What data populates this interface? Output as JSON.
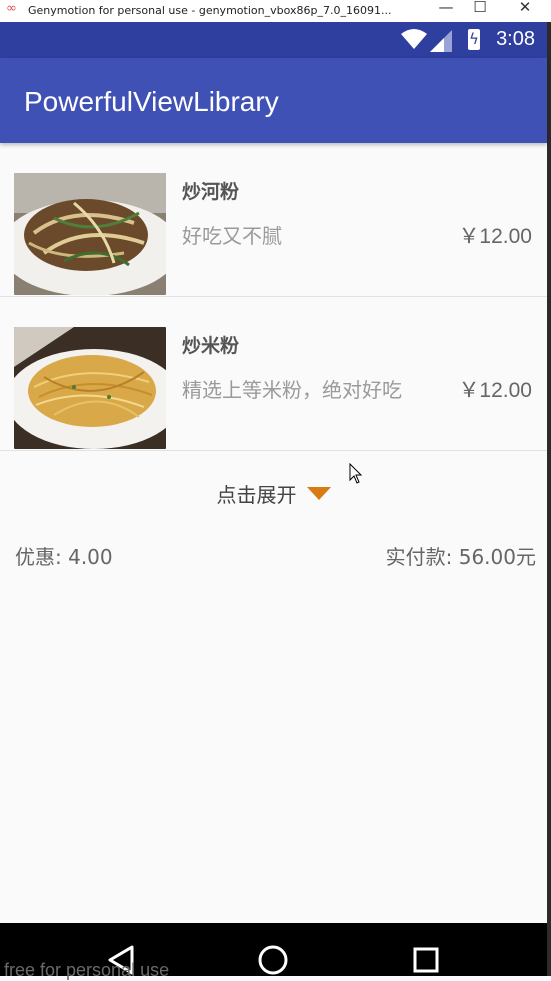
{
  "window": {
    "title": "Genymotion for personal use - genymotion_vbox86p_7.0_16091...",
    "minimize_glyph": "—",
    "maximize_glyph": "☐",
    "close_glyph": "✕"
  },
  "status_bar": {
    "time": "3:08",
    "icons": [
      "wifi-icon",
      "signal-icon",
      "battery-charging-icon"
    ]
  },
  "app_bar": {
    "title": "PowerfulViewLibrary"
  },
  "items": [
    {
      "name": "炒河粉",
      "description": "好吃又不腻",
      "price": "￥12.00",
      "image": "stir-fried-rice-noodles-photo"
    },
    {
      "name": "炒米粉",
      "description": "精选上等米粉，绝对好吃",
      "price": "￥12.00",
      "image": "fried-vermicelli-photo"
    }
  ],
  "expand": {
    "label": "点击展开",
    "icon": "triangle-down-icon"
  },
  "summary": {
    "discount": "优惠: 4.00",
    "total": "实付款: 56.00元"
  },
  "nav_bar": {
    "buttons": [
      "back-icon",
      "home-icon",
      "recents-icon"
    ]
  },
  "watermark": "free for personal use",
  "colors": {
    "status_bar": "#2f3fa0",
    "app_bar": "#3f51b5",
    "accent_arrow": "#d97a14",
    "background": "#fafafa"
  }
}
